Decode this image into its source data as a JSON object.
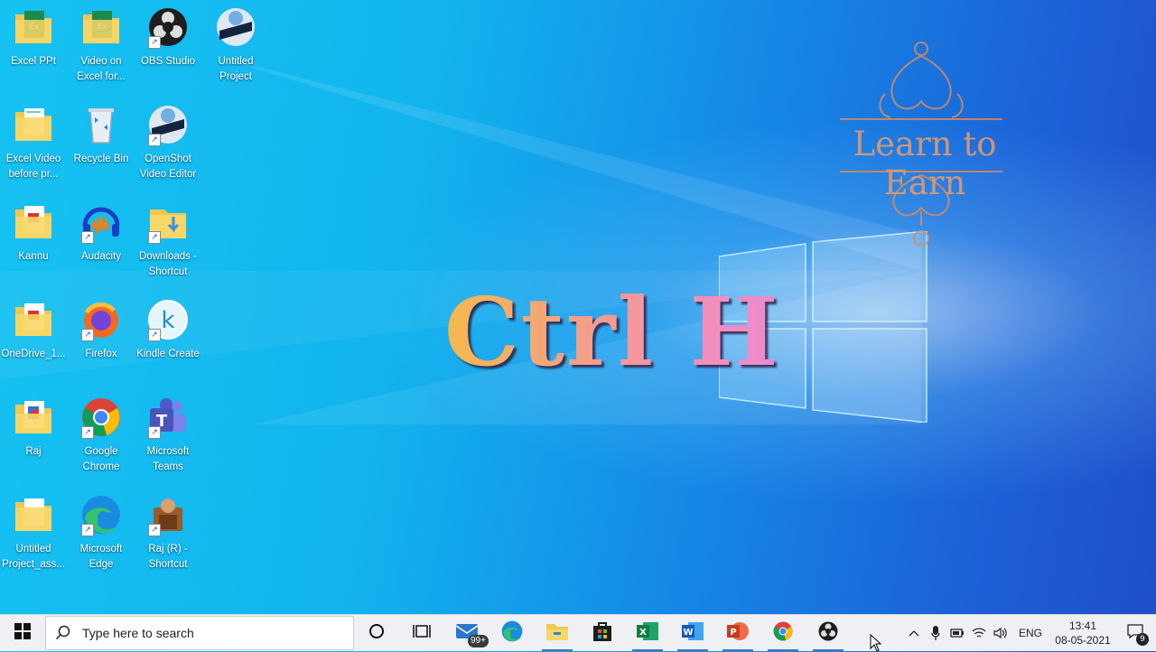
{
  "desktop": {
    "icons": [
      {
        "label": "Excel PPt",
        "icon": "excel-folder-icon"
      },
      {
        "label": "Video on Excel for...",
        "icon": "excel-folder-icon"
      },
      {
        "label": "OBS Studio",
        "icon": "obs-icon"
      },
      {
        "label": "Untitled Project",
        "icon": "openshot-icon"
      },
      {
        "label": "Excel Video before pr...",
        "icon": "folder-icon"
      },
      {
        "label": "Recycle Bin",
        "icon": "recycle-bin-icon"
      },
      {
        "label": "OpenShot Video Editor",
        "icon": "openshot-icon"
      },
      {
        "label": "Kannu",
        "icon": "pdf-folder-icon"
      },
      {
        "label": "Audacity",
        "icon": "audacity-icon"
      },
      {
        "label": "Downloads - Shortcut",
        "icon": "downloads-folder-icon"
      },
      {
        "label": "OneDrive_1...",
        "icon": "pdf-folder-icon"
      },
      {
        "label": "Firefox",
        "icon": "firefox-icon"
      },
      {
        "label": "Kindle Create",
        "icon": "kindle-icon"
      },
      {
        "label": "Raj",
        "icon": "pdf-folder-icon"
      },
      {
        "label": "Google Chrome",
        "icon": "chrome-icon"
      },
      {
        "label": "Microsoft Teams",
        "icon": "teams-icon"
      },
      {
        "label": "Untitled Project_ass...",
        "icon": "folder-icon"
      },
      {
        "label": "Microsoft Edge",
        "icon": "edge-icon"
      },
      {
        "label": "Raj (R) - Shortcut",
        "icon": "user-folder-icon"
      }
    ]
  },
  "overlay": {
    "headline": "Ctrl H",
    "logo_text": "Learn to Earn"
  },
  "taskbar": {
    "search_placeholder": "Type here to search",
    "mail_badge": "99+",
    "pinned": [
      "cortana",
      "task-view",
      "mail",
      "edge",
      "file-explorer",
      "microsoft-store",
      "excel",
      "word",
      "powerpoint",
      "chrome",
      "obs"
    ],
    "language": "ENG",
    "time": "13:41",
    "date": "08-05-2021",
    "notification_count": "9"
  },
  "colors": {
    "accent": "#4a73b3",
    "headline_gradient": [
      "#f5b94d",
      "#f58fb7",
      "#e98ad0"
    ],
    "logo": "#e09a6e"
  }
}
